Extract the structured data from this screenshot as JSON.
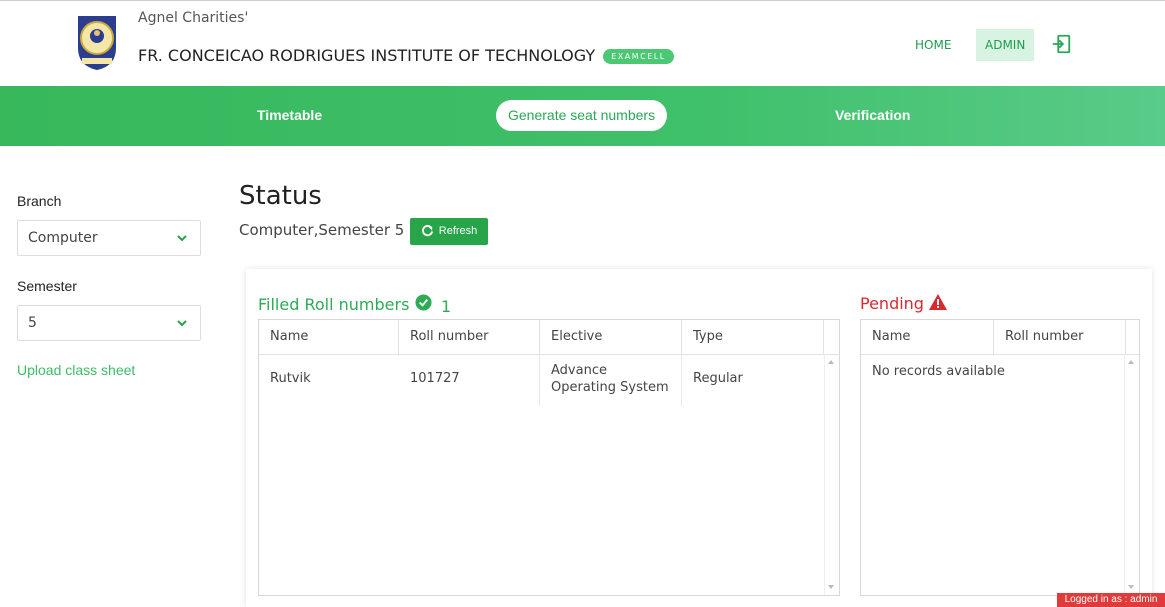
{
  "header": {
    "org_line1": "Agnel Charities'",
    "org_line2": "FR. CONCEICAO RODRIGUES INSTITUTE OF TECHNOLOGY",
    "badge": "EXAMCELL",
    "nav": {
      "home": "HOME",
      "admin": "ADMIN"
    },
    "icons": {
      "logo": "college-crest-logo",
      "logout": "logout-icon"
    }
  },
  "tabs": {
    "timetable": "Timetable",
    "generate": "Generate seat numbers",
    "verification": "Verification"
  },
  "sidebar": {
    "branch_label": "Branch",
    "branch_value": "Computer",
    "semester_label": "Semester",
    "semester_value": "5",
    "upload_link": "Upload class sheet"
  },
  "main": {
    "title": "Status",
    "subtitle": "Computer,Semester 5",
    "refresh_label": "Refresh",
    "filled": {
      "heading": "Filled Roll numbers",
      "count": "1",
      "columns": [
        "Name",
        "Roll number",
        "Elective",
        "Type"
      ],
      "rows": [
        {
          "name": "Rutvik",
          "roll": "101727",
          "elective": "Advance Operating System",
          "type": "Regular"
        }
      ]
    },
    "pending": {
      "heading": "Pending",
      "columns": [
        "Name",
        "Roll number"
      ],
      "empty_text": "No records available"
    }
  },
  "footer": {
    "logged_in": "Logged in as : admin"
  },
  "colors": {
    "brand_green": "#3fc06a",
    "pending_red": "#d8292f",
    "badge_red": "#e03a3a"
  }
}
